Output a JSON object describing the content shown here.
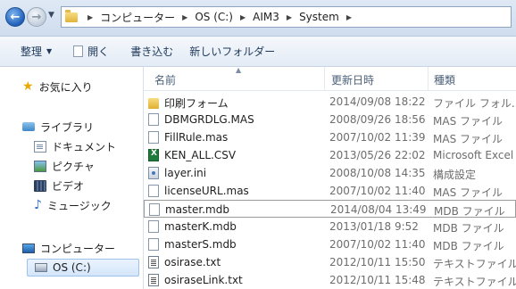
{
  "address": {
    "crumbs": [
      "コンピューター",
      "OS (C:)",
      "AIM3",
      "System"
    ]
  },
  "toolbar": {
    "organize": "整理",
    "open": "開く",
    "burn": "書き込む",
    "new_folder": "新しいフォルダー"
  },
  "nav": {
    "favorites": "お気に入り",
    "libraries": "ライブラリ",
    "documents": "ドキュメント",
    "pictures": "ピクチャ",
    "videos": "ビデオ",
    "music": "ミュージック",
    "computer": "コンピューター",
    "drive_c": "OS (C:)"
  },
  "columns": {
    "name": "名前",
    "date": "更新日時",
    "type": "種類"
  },
  "files": [
    {
      "name": "印刷フォーム",
      "date": "2014/09/08 18:22",
      "type": "ファイル フォル...",
      "icon": "folder-icon"
    },
    {
      "name": "DBMGRDLG.MAS",
      "date": "2008/09/26 18:56",
      "type": "MAS ファイル",
      "icon": "file-icon"
    },
    {
      "name": "FillRule.mas",
      "date": "2007/10/02 11:39",
      "type": "MAS ファイル",
      "icon": "file-icon"
    },
    {
      "name": "KEN_ALL.CSV",
      "date": "2013/05/26 22:02",
      "type": "Microsoft Excel ...",
      "icon": "excel-icon"
    },
    {
      "name": "layer.ini",
      "date": "2008/10/08 14:35",
      "type": "構成設定",
      "icon": "settings-file-icon"
    },
    {
      "name": "licenseURL.mas",
      "date": "2007/10/02 11:40",
      "type": "MAS ファイル",
      "icon": "file-icon"
    },
    {
      "name": "master.mdb",
      "date": "2014/08/04 13:49",
      "type": "MDB ファイル",
      "icon": "file-icon"
    },
    {
      "name": "masterK.mdb",
      "date": "2013/01/18 9:52",
      "type": "MDB ファイル",
      "icon": "file-icon"
    },
    {
      "name": "masterS.mdb",
      "date": "2007/10/02 11:40",
      "type": "MDB ファイル",
      "icon": "file-icon"
    },
    {
      "name": "osirase.txt",
      "date": "2012/10/11 15:50",
      "type": "テキストファイル",
      "icon": "text-file-icon"
    },
    {
      "name": "osiraseLink.txt",
      "date": "2012/10/11 15:48",
      "type": "テキストファイル",
      "icon": "text-file-icon"
    }
  ],
  "selected_file": "master.mdb"
}
